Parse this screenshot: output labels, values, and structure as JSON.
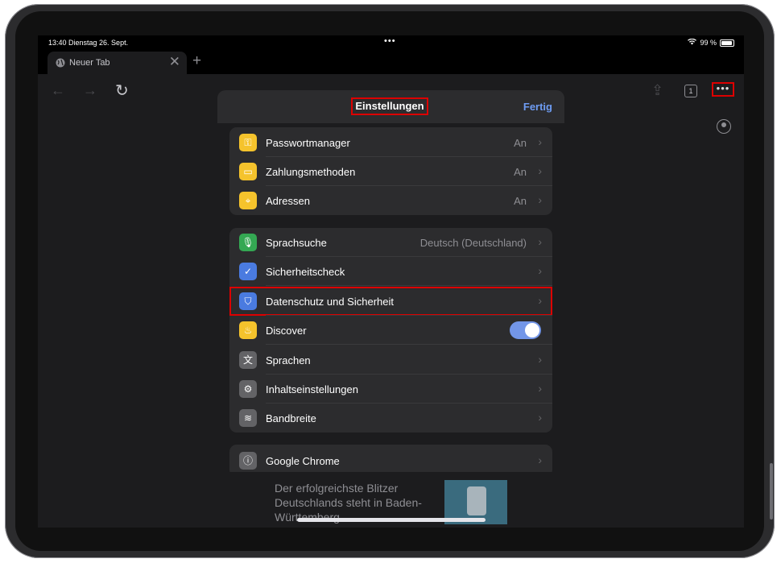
{
  "status_bar": {
    "time": "13:40  Dienstag 26. Sept.",
    "dots": "•••",
    "battery": "99 %"
  },
  "tab": {
    "title": "Neuer Tab",
    "close": "✕",
    "new": "+"
  },
  "toolbar": {
    "back": "←",
    "forward": "→",
    "reload": "↻",
    "share": "⇪",
    "tab_count": "1",
    "menu": "•••"
  },
  "settings": {
    "title": "Einstellungen",
    "done": "Fertig",
    "group1": [
      {
        "label": "Passwortmanager",
        "value": "An",
        "icon": "key-icon",
        "color": "#f5c32c"
      },
      {
        "label": "Zahlungsmethoden",
        "value": "An",
        "icon": "card-icon",
        "color": "#f5c32c"
      },
      {
        "label": "Adressen",
        "value": "An",
        "icon": "location-pin-icon",
        "color": "#f5c32c"
      }
    ],
    "group2": [
      {
        "label": "Sprachsuche",
        "value": "Deutsch (Deutschland)",
        "icon": "microphone-icon",
        "color": "#34a853"
      },
      {
        "label": "Sicherheitscheck",
        "value": "",
        "icon": "shield-check-icon",
        "color": "#4a7be0"
      },
      {
        "label": "Datenschutz und Sicherheit",
        "value": "",
        "icon": "shield-icon",
        "color": "#4a7be0"
      },
      {
        "label": "Discover",
        "value": "",
        "icon": "flame-icon",
        "color": "#f5c32c",
        "toggle": true
      },
      {
        "label": "Sprachen",
        "value": "",
        "icon": "translate-icon",
        "color": "#636366"
      },
      {
        "label": "Inhaltseinstellungen",
        "value": "",
        "icon": "gear-icon",
        "color": "#636366"
      },
      {
        "label": "Bandbreite",
        "value": "",
        "icon": "wifi-icon",
        "color": "#636366"
      }
    ],
    "group3": [
      {
        "label": "Google Chrome",
        "value": "",
        "icon": "info-icon",
        "color": "#636366"
      }
    ]
  },
  "news": {
    "headline": "Der erfolgreichste Blitzer Deutschlands steht in Baden-Württemberg"
  }
}
